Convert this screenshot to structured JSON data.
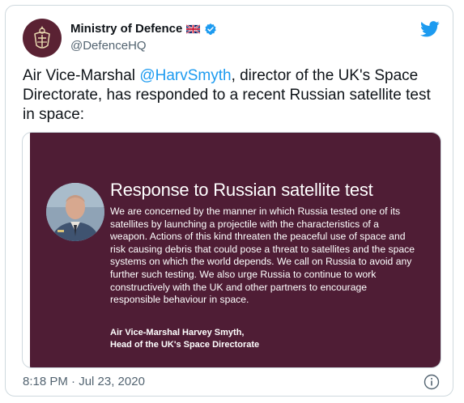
{
  "account": {
    "display_name": "Ministry of Defence",
    "handle": "@DefenceHQ",
    "avatar_icon": "mod-crest-icon",
    "verified_icon": "verified-badge-icon",
    "flag_icon": "union-jack-flag-icon",
    "avatar_color": "#5a2233"
  },
  "tweet": {
    "text_before_mention": "Air Vice-Marshal ",
    "mention": "@HarvSmyth",
    "text_after_mention": ", director of the UK's Space Directorate, has responded to a recent Russian satellite test in space:",
    "timestamp": "8:18 PM · Jul 23, 2020"
  },
  "media": {
    "background_color": "#4f1d35",
    "title": "Response to Russian satellite test",
    "body": "We are concerned by the manner in which Russia tested one of its satellites by launching a projectile with the characteristics of a weapon. Actions of this kind threaten the peaceful use of space and risk causing debris that could pose a threat to satellites and the space systems on which the world depends. We call on Russia to avoid any further such testing. We also urge Russia to continue to work constructively with the UK and other partners to encourage responsible behaviour in space.",
    "signature_name": "Air Vice-Marshal Harvey Smyth,",
    "signature_role": "Head of the UK's Space Directorate"
  },
  "icons": {
    "brand": "twitter-bird-icon",
    "info": "info-icon"
  },
  "colors": {
    "accent": "#1d9bf0",
    "text_primary": "#0f1419",
    "text_secondary": "#536471"
  }
}
